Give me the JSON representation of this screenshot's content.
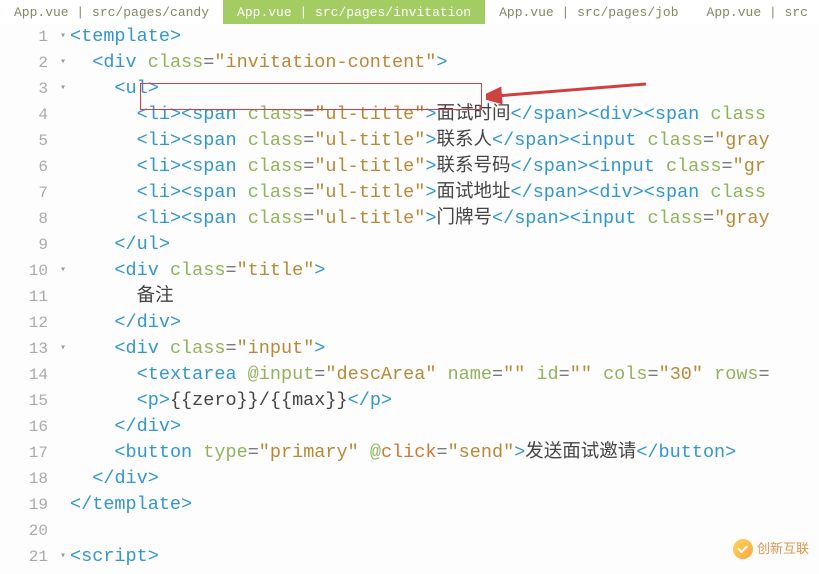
{
  "tabs": [
    {
      "label": "App.vue | src/pages/candy",
      "active": false
    },
    {
      "label": "App.vue | src/pages/invitation",
      "active": true
    },
    {
      "label": "App.vue | src/pages/job",
      "active": false
    },
    {
      "label": "App.vue | src",
      "active": false
    }
  ],
  "highlighted_attr": "class=\"invitation-content\"",
  "watermark": "创新互联",
  "code_lines": [
    {
      "n": 1,
      "fold": "▸",
      "indent": 0,
      "tokens": [
        {
          "t": "<",
          "c": "t-tag"
        },
        {
          "t": "template",
          "c": "t-tag"
        },
        {
          "t": ">",
          "c": "t-tag"
        }
      ]
    },
    {
      "n": 2,
      "fold": "▸",
      "indent": 1,
      "tokens": [
        {
          "t": "<",
          "c": "t-tag"
        },
        {
          "t": "div",
          "c": "t-tag"
        },
        {
          "t": " ",
          "c": ""
        },
        {
          "t": "class",
          "c": "t-attr"
        },
        {
          "t": "=",
          "c": "t-punct"
        },
        {
          "t": "\"invitation-content\"",
          "c": "t-str"
        },
        {
          "t": ">",
          "c": "t-tag"
        }
      ]
    },
    {
      "n": 3,
      "fold": "▸",
      "indent": 2,
      "tokens": [
        {
          "t": "<",
          "c": "t-tag"
        },
        {
          "t": "ul",
          "c": "t-tag"
        },
        {
          "t": ">",
          "c": "t-tag"
        }
      ]
    },
    {
      "n": 4,
      "fold": "",
      "indent": 3,
      "tokens": [
        {
          "t": "<",
          "c": "t-tag"
        },
        {
          "t": "li",
          "c": "t-tag"
        },
        {
          "t": ">",
          "c": "t-tag"
        },
        {
          "t": "<",
          "c": "t-tag"
        },
        {
          "t": "span",
          "c": "t-tag"
        },
        {
          "t": " ",
          "c": ""
        },
        {
          "t": "class",
          "c": "t-attr"
        },
        {
          "t": "=",
          "c": "t-punct"
        },
        {
          "t": "\"ul-title\"",
          "c": "t-str"
        },
        {
          "t": ">",
          "c": "t-tag"
        },
        {
          "t": "面试时间",
          "c": "t-text"
        },
        {
          "t": "</",
          "c": "t-tag"
        },
        {
          "t": "span",
          "c": "t-tag"
        },
        {
          "t": ">",
          "c": "t-tag"
        },
        {
          "t": "<",
          "c": "t-tag"
        },
        {
          "t": "div",
          "c": "t-tag"
        },
        {
          "t": ">",
          "c": "t-tag"
        },
        {
          "t": "<",
          "c": "t-tag"
        },
        {
          "t": "span",
          "c": "t-tag"
        },
        {
          "t": " ",
          "c": ""
        },
        {
          "t": "class",
          "c": "t-attr"
        }
      ]
    },
    {
      "n": 5,
      "fold": "",
      "indent": 3,
      "tokens": [
        {
          "t": "<",
          "c": "t-tag"
        },
        {
          "t": "li",
          "c": "t-tag"
        },
        {
          "t": ">",
          "c": "t-tag"
        },
        {
          "t": "<",
          "c": "t-tag"
        },
        {
          "t": "span",
          "c": "t-tag"
        },
        {
          "t": " ",
          "c": ""
        },
        {
          "t": "class",
          "c": "t-attr"
        },
        {
          "t": "=",
          "c": "t-punct"
        },
        {
          "t": "\"ul-title\"",
          "c": "t-str"
        },
        {
          "t": ">",
          "c": "t-tag"
        },
        {
          "t": "联系人",
          "c": "t-text"
        },
        {
          "t": "</",
          "c": "t-tag"
        },
        {
          "t": "span",
          "c": "t-tag"
        },
        {
          "t": ">",
          "c": "t-tag"
        },
        {
          "t": "<",
          "c": "t-tag"
        },
        {
          "t": "input",
          "c": "t-tag"
        },
        {
          "t": " ",
          "c": ""
        },
        {
          "t": "class",
          "c": "t-attr"
        },
        {
          "t": "=",
          "c": "t-punct"
        },
        {
          "t": "\"gray",
          "c": "t-str"
        }
      ]
    },
    {
      "n": 6,
      "fold": "",
      "indent": 3,
      "tokens": [
        {
          "t": "<",
          "c": "t-tag"
        },
        {
          "t": "li",
          "c": "t-tag"
        },
        {
          "t": ">",
          "c": "t-tag"
        },
        {
          "t": "<",
          "c": "t-tag"
        },
        {
          "t": "span",
          "c": "t-tag"
        },
        {
          "t": " ",
          "c": ""
        },
        {
          "t": "class",
          "c": "t-attr"
        },
        {
          "t": "=",
          "c": "t-punct"
        },
        {
          "t": "\"ul-title\"",
          "c": "t-str"
        },
        {
          "t": ">",
          "c": "t-tag"
        },
        {
          "t": "联系号码",
          "c": "t-text"
        },
        {
          "t": "</",
          "c": "t-tag"
        },
        {
          "t": "span",
          "c": "t-tag"
        },
        {
          "t": ">",
          "c": "t-tag"
        },
        {
          "t": "<",
          "c": "t-tag"
        },
        {
          "t": "input",
          "c": "t-tag"
        },
        {
          "t": " ",
          "c": ""
        },
        {
          "t": "class",
          "c": "t-attr"
        },
        {
          "t": "=",
          "c": "t-punct"
        },
        {
          "t": "\"gr",
          "c": "t-str"
        }
      ]
    },
    {
      "n": 7,
      "fold": "",
      "indent": 3,
      "tokens": [
        {
          "t": "<",
          "c": "t-tag"
        },
        {
          "t": "li",
          "c": "t-tag"
        },
        {
          "t": ">",
          "c": "t-tag"
        },
        {
          "t": "<",
          "c": "t-tag"
        },
        {
          "t": "span",
          "c": "t-tag"
        },
        {
          "t": " ",
          "c": ""
        },
        {
          "t": "class",
          "c": "t-attr"
        },
        {
          "t": "=",
          "c": "t-punct"
        },
        {
          "t": "\"ul-title\"",
          "c": "t-str"
        },
        {
          "t": ">",
          "c": "t-tag"
        },
        {
          "t": "面试地址",
          "c": "t-text"
        },
        {
          "t": "</",
          "c": "t-tag"
        },
        {
          "t": "span",
          "c": "t-tag"
        },
        {
          "t": ">",
          "c": "t-tag"
        },
        {
          "t": "<",
          "c": "t-tag"
        },
        {
          "t": "div",
          "c": "t-tag"
        },
        {
          "t": ">",
          "c": "t-tag"
        },
        {
          "t": "<",
          "c": "t-tag"
        },
        {
          "t": "span",
          "c": "t-tag"
        },
        {
          "t": " ",
          "c": ""
        },
        {
          "t": "class",
          "c": "t-attr"
        }
      ]
    },
    {
      "n": 8,
      "fold": "",
      "indent": 3,
      "tokens": [
        {
          "t": "<",
          "c": "t-tag"
        },
        {
          "t": "li",
          "c": "t-tag"
        },
        {
          "t": ">",
          "c": "t-tag"
        },
        {
          "t": "<",
          "c": "t-tag"
        },
        {
          "t": "span",
          "c": "t-tag"
        },
        {
          "t": " ",
          "c": ""
        },
        {
          "t": "class",
          "c": "t-attr"
        },
        {
          "t": "=",
          "c": "t-punct"
        },
        {
          "t": "\"ul-title\"",
          "c": "t-str"
        },
        {
          "t": ">",
          "c": "t-tag"
        },
        {
          "t": "门牌号",
          "c": "t-text"
        },
        {
          "t": "</",
          "c": "t-tag"
        },
        {
          "t": "span",
          "c": "t-tag"
        },
        {
          "t": ">",
          "c": "t-tag"
        },
        {
          "t": "<",
          "c": "t-tag"
        },
        {
          "t": "input",
          "c": "t-tag"
        },
        {
          "t": " ",
          "c": ""
        },
        {
          "t": "class",
          "c": "t-attr"
        },
        {
          "t": "=",
          "c": "t-punct"
        },
        {
          "t": "\"gray",
          "c": "t-str"
        }
      ]
    },
    {
      "n": 9,
      "fold": "",
      "indent": 2,
      "tokens": [
        {
          "t": "</",
          "c": "t-tag"
        },
        {
          "t": "ul",
          "c": "t-tag"
        },
        {
          "t": ">",
          "c": "t-tag"
        }
      ]
    },
    {
      "n": 10,
      "fold": "▸",
      "indent": 2,
      "tokens": [
        {
          "t": "<",
          "c": "t-tag"
        },
        {
          "t": "div",
          "c": "t-tag"
        },
        {
          "t": " ",
          "c": ""
        },
        {
          "t": "class",
          "c": "t-attr"
        },
        {
          "t": "=",
          "c": "t-punct"
        },
        {
          "t": "\"title\"",
          "c": "t-str"
        },
        {
          "t": ">",
          "c": "t-tag"
        }
      ]
    },
    {
      "n": 11,
      "fold": "",
      "indent": 3,
      "tokens": [
        {
          "t": "备注",
          "c": "t-text"
        }
      ]
    },
    {
      "n": 12,
      "fold": "",
      "indent": 2,
      "tokens": [
        {
          "t": "</",
          "c": "t-tag"
        },
        {
          "t": "div",
          "c": "t-tag"
        },
        {
          "t": ">",
          "c": "t-tag"
        }
      ]
    },
    {
      "n": 13,
      "fold": "▸",
      "indent": 2,
      "tokens": [
        {
          "t": "<",
          "c": "t-tag"
        },
        {
          "t": "div",
          "c": "t-tag"
        },
        {
          "t": " ",
          "c": ""
        },
        {
          "t": "class",
          "c": "t-attr"
        },
        {
          "t": "=",
          "c": "t-punct"
        },
        {
          "t": "\"input\"",
          "c": "t-str"
        },
        {
          "t": ">",
          "c": "t-tag"
        }
      ]
    },
    {
      "n": 14,
      "fold": "",
      "indent": 3,
      "tokens": [
        {
          "t": "<",
          "c": "t-tag"
        },
        {
          "t": "textarea",
          "c": "t-tag"
        },
        {
          "t": " ",
          "c": ""
        },
        {
          "t": "@",
          "c": "t-attr"
        },
        {
          "t": "input",
          "c": "t-attr"
        },
        {
          "t": "=",
          "c": "t-punct"
        },
        {
          "t": "\"descArea\"",
          "c": "t-str"
        },
        {
          "t": " ",
          "c": ""
        },
        {
          "t": "name",
          "c": "t-attr"
        },
        {
          "t": "=",
          "c": "t-punct"
        },
        {
          "t": "\"\"",
          "c": "t-str"
        },
        {
          "t": " ",
          "c": ""
        },
        {
          "t": "id",
          "c": "t-attr"
        },
        {
          "t": "=",
          "c": "t-punct"
        },
        {
          "t": "\"\"",
          "c": "t-str"
        },
        {
          "t": " ",
          "c": ""
        },
        {
          "t": "cols",
          "c": "t-attr"
        },
        {
          "t": "=",
          "c": "t-punct"
        },
        {
          "t": "\"30\"",
          "c": "t-str"
        },
        {
          "t": " ",
          "c": ""
        },
        {
          "t": "rows",
          "c": "t-attr"
        },
        {
          "t": "=",
          "c": "t-punct"
        }
      ]
    },
    {
      "n": 15,
      "fold": "",
      "indent": 3,
      "tokens": [
        {
          "t": "<",
          "c": "t-tag"
        },
        {
          "t": "p",
          "c": "t-tag"
        },
        {
          "t": ">",
          "c": "t-tag"
        },
        {
          "t": "{{zero}}/{{max}}",
          "c": "t-text"
        },
        {
          "t": "</",
          "c": "t-tag"
        },
        {
          "t": "p",
          "c": "t-tag"
        },
        {
          "t": ">",
          "c": "t-tag"
        }
      ]
    },
    {
      "n": 16,
      "fold": "",
      "indent": 2,
      "tokens": [
        {
          "t": "</",
          "c": "t-tag"
        },
        {
          "t": "div",
          "c": "t-tag"
        },
        {
          "t": ">",
          "c": "t-tag"
        }
      ]
    },
    {
      "n": 17,
      "fold": "",
      "indent": 2,
      "tokens": [
        {
          "t": "<",
          "c": "t-tag"
        },
        {
          "t": "button",
          "c": "t-tag"
        },
        {
          "t": " ",
          "c": ""
        },
        {
          "t": "type",
          "c": "t-attr"
        },
        {
          "t": "=",
          "c": "t-punct"
        },
        {
          "t": "\"primary\"",
          "c": "t-str"
        },
        {
          "t": " ",
          "c": ""
        },
        {
          "t": "@",
          "c": "t-attr"
        },
        {
          "t": "click",
          "c": "t-click"
        },
        {
          "t": "=",
          "c": "t-punct"
        },
        {
          "t": "\"send\"",
          "c": "t-str"
        },
        {
          "t": ">",
          "c": "t-tag"
        },
        {
          "t": "发送面试邀请",
          "c": "t-text"
        },
        {
          "t": "</",
          "c": "t-tag"
        },
        {
          "t": "button",
          "c": "t-tag"
        },
        {
          "t": ">",
          "c": "t-tag"
        }
      ]
    },
    {
      "n": 18,
      "fold": "",
      "indent": 1,
      "tokens": [
        {
          "t": "</",
          "c": "t-tag"
        },
        {
          "t": "div",
          "c": "t-tag"
        },
        {
          "t": ">",
          "c": "t-tag"
        }
      ]
    },
    {
      "n": 19,
      "fold": "",
      "indent": 0,
      "tokens": [
        {
          "t": "</",
          "c": "t-tag"
        },
        {
          "t": "template",
          "c": "t-tag"
        },
        {
          "t": ">",
          "c": "t-tag"
        }
      ]
    },
    {
      "n": 20,
      "fold": "",
      "indent": 0,
      "tokens": []
    },
    {
      "n": 21,
      "fold": "▸",
      "indent": 0,
      "tokens": [
        {
          "t": "<",
          "c": "t-tag"
        },
        {
          "t": "script",
          "c": "t-tag"
        },
        {
          "t": ">",
          "c": "t-tag"
        }
      ]
    }
  ]
}
